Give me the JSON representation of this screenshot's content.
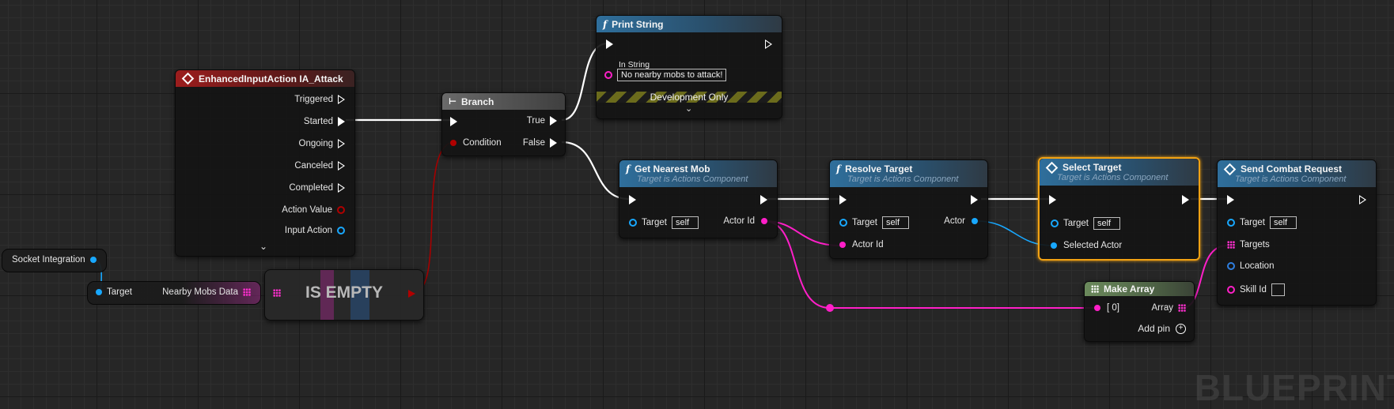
{
  "nodes": {
    "input_action": {
      "title": "EnhancedInputAction IA_Attack",
      "pins": {
        "triggered": "Triggered",
        "started": "Started",
        "ongoing": "Ongoing",
        "canceled": "Canceled",
        "completed": "Completed",
        "action_value": "Action Value",
        "input_action": "Input Action"
      }
    },
    "branch": {
      "title": "Branch",
      "condition": "Condition",
      "true_label": "True",
      "false_label": "False"
    },
    "print_string": {
      "title": "Print String",
      "in_string_label": "In String",
      "in_string_value": "No nearby mobs to attack!",
      "dev_only": "Development Only"
    },
    "get_nearest_mob": {
      "title": "Get Nearest Mob",
      "subtitle": "Target is Actions Component",
      "target_label": "Target",
      "target_value": "self",
      "actor_id": "Actor Id"
    },
    "resolve_target": {
      "title": "Resolve Target",
      "subtitle": "Target is Actions Component",
      "target_label": "Target",
      "target_value": "self",
      "actor_label": "Actor",
      "actor_id": "Actor Id"
    },
    "select_target": {
      "title": "Select Target",
      "subtitle": "Target is Actions Component",
      "target_label": "Target",
      "target_value": "self",
      "selected_actor": "Selected Actor"
    },
    "send_combat_request": {
      "title": "Send Combat Request",
      "subtitle": "Target is Actions Component",
      "target_label": "Target",
      "target_value": "self",
      "targets": "Targets",
      "location": "Location",
      "skill_id": "Skill Id"
    },
    "make_array": {
      "title": "Make Array",
      "index0": "[ 0]",
      "array_label": "Array",
      "add_pin": "Add pin"
    },
    "socket_integration": {
      "label": "Socket Integration"
    },
    "nearby_mobs": {
      "target_label": "Target",
      "output_label": "Nearby Mobs Data"
    },
    "is_empty": {
      "label": "IS EMPTY"
    }
  },
  "watermark": "BLUEPRINT",
  "colors": {
    "exec": "#ffffff",
    "object": "#18a8ff",
    "int": "#ff1fc8",
    "bool": "#b00000",
    "selection": "#f2a213"
  }
}
